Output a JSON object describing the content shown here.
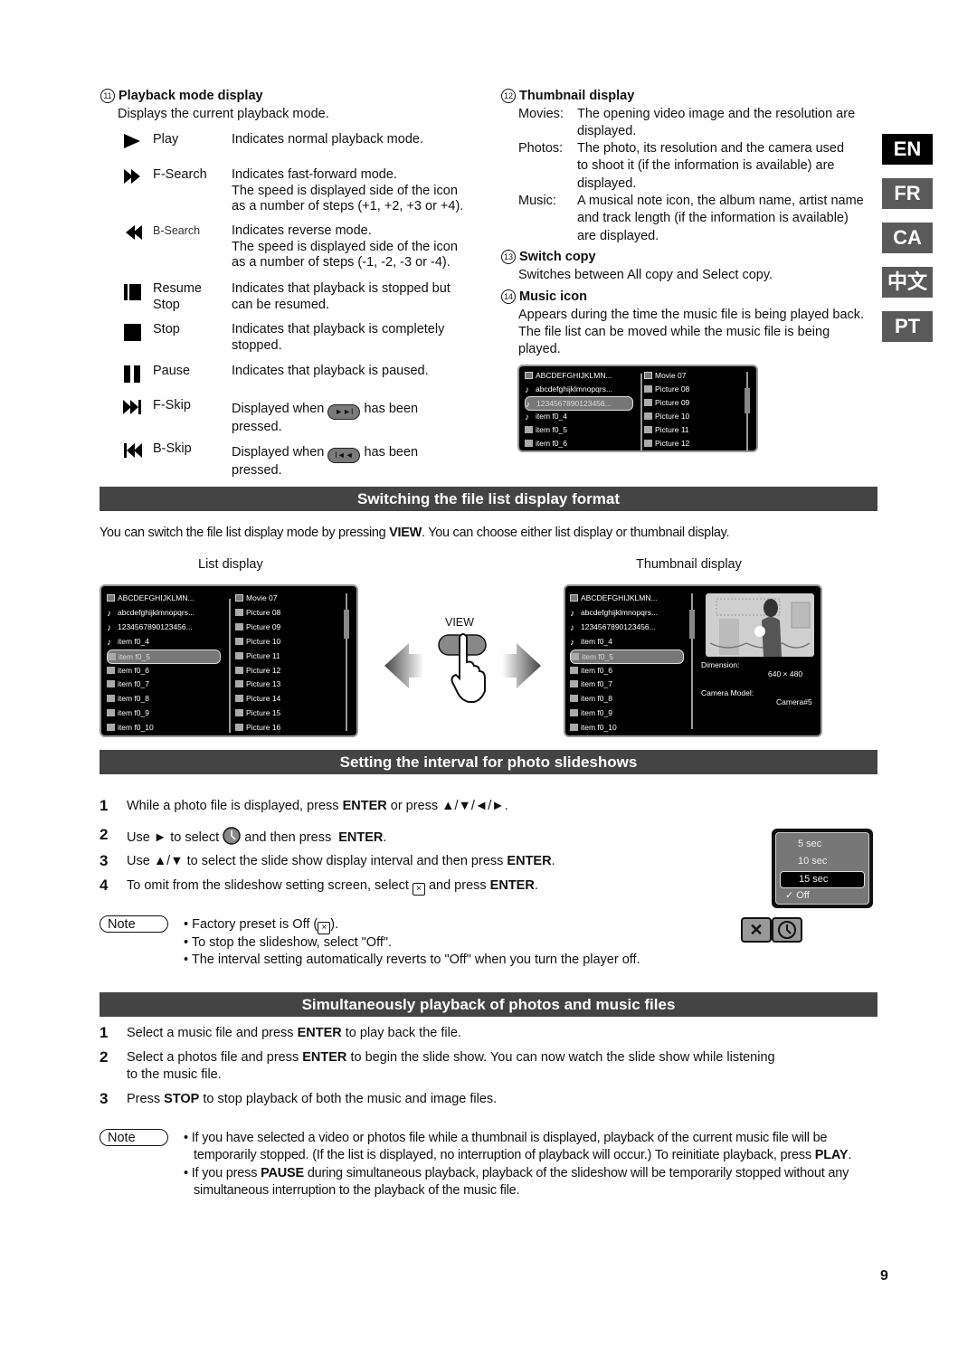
{
  "playback_mode": {
    "number": "11",
    "title": "Playback mode display",
    "intro": "Displays the current playback mode.",
    "modes": [
      {
        "icon": "play-icon",
        "name": "Play",
        "desc": "Indicates normal playback mode."
      },
      {
        "icon": "fast-forward-icon",
        "name": "F-Search",
        "desc": "Indicates fast-forward mode.",
        "desc2": "The speed is displayed side of the icon",
        "desc3": "as a number of steps (+1, +2, +3 or +4)."
      },
      {
        "icon": "rewind-icon",
        "name": "B-Search",
        "desc": "Indicates reverse mode.",
        "desc2": "The speed is displayed side of the icon",
        "desc3": "as a number of steps (-1, -2, -3 or -4)."
      },
      {
        "icon": "resume-stop-icon",
        "name": "Resume",
        "name2": "Stop",
        "desc": "Indicates that playback is stopped but",
        "desc2": "can be resumed."
      },
      {
        "icon": "stop-icon",
        "name": "Stop",
        "desc": "Indicates that playback is completely",
        "desc2": "stopped."
      },
      {
        "icon": "pause-icon",
        "name": "Pause",
        "desc": "Indicates that playback is paused."
      },
      {
        "icon": "skip-forward-icon",
        "name": "F-Skip",
        "desc_pre": "Displayed when",
        "desc_post": "has been",
        "desc2": "pressed.",
        "button_glyph": "►►I"
      },
      {
        "icon": "skip-back-icon",
        "name": "B-Skip",
        "desc_pre": "Displayed when",
        "desc_post": "has been",
        "desc2": "pressed.",
        "button_glyph": "I◄◄"
      }
    ]
  },
  "thumbnail_display": {
    "number": "12",
    "title": "Thumbnail display",
    "items": [
      {
        "key": "Movies:",
        "lines": [
          "The opening video image and the resolution are",
          "displayed."
        ]
      },
      {
        "key": "Photos:",
        "lines": [
          "The photo, its resolution and the camera used",
          "to shoot it (if the information is available) are",
          "displayed."
        ]
      },
      {
        "key": "Music:",
        "lines": [
          "A musical note icon, the album name, artist name",
          "and track length (if the information is available)",
          "are displayed."
        ]
      }
    ]
  },
  "switch_copy": {
    "number": "13",
    "title": "Switch copy",
    "text": "Switches between All copy and Select copy."
  },
  "music_icon": {
    "number": "14",
    "title": "Music icon",
    "lines": [
      "Appears during the time the music file is being played back.",
      "The file list can be moved while the music file is being",
      "played."
    ]
  },
  "music_screen": {
    "left": [
      {
        "type": "folder",
        "label": "ABCDEFGHIJKLMN..."
      },
      {
        "type": "note",
        "label": "abcdefghijklmnopqrs..."
      },
      {
        "type": "note",
        "label": "1234567890123456...",
        "selected": true
      },
      {
        "type": "note",
        "label": "item f0_4"
      },
      {
        "type": "photo",
        "label": "item f0_5"
      },
      {
        "type": "photo",
        "label": "item f0_6"
      }
    ],
    "right": [
      {
        "type": "folder",
        "label": "Movie 07"
      },
      {
        "type": "photo",
        "label": "Picture 08"
      },
      {
        "type": "photo",
        "label": "Picture 09"
      },
      {
        "type": "photo",
        "label": "Picture 10"
      },
      {
        "type": "photo",
        "label": "Picture 11"
      },
      {
        "type": "photo",
        "label": "Picture 12"
      }
    ]
  },
  "languages": [
    {
      "code": "EN",
      "active": true
    },
    {
      "code": "FR"
    },
    {
      "code": "CA"
    },
    {
      "code": "中文"
    },
    {
      "code": "PT"
    }
  ],
  "section_switch": {
    "title": "Switching the file list display format",
    "intro_pre": "You can switch the file list display mode by pressing ",
    "intro_bold": "VIEW",
    "intro_post": ". You can choose either list display or thumbnail display.",
    "list_label": "List display",
    "thumb_label": "Thumbnail display",
    "view_label": "VIEW"
  },
  "list_screen": {
    "left": [
      {
        "type": "folder",
        "label": "ABCDEFGHIJKLMN..."
      },
      {
        "type": "note",
        "label": "abcdefghijklmnopqrs..."
      },
      {
        "type": "note",
        "label": "1234567890123456..."
      },
      {
        "type": "note",
        "label": "item f0_4"
      },
      {
        "type": "photo",
        "label": "item f0_5",
        "selected": true
      },
      {
        "type": "photo",
        "label": "item f0_6"
      },
      {
        "type": "photo",
        "label": "item f0_7"
      },
      {
        "type": "photo",
        "label": "item f0_8"
      },
      {
        "type": "photo",
        "label": "item f0_9"
      },
      {
        "type": "photo",
        "label": "item f0_10"
      }
    ],
    "right": [
      {
        "type": "folder",
        "label": "Movie 07"
      },
      {
        "type": "photo",
        "label": "Picture 08"
      },
      {
        "type": "photo",
        "label": "Picture 09"
      },
      {
        "type": "photo",
        "label": "Picture 10"
      },
      {
        "type": "photo",
        "label": "Picture 11"
      },
      {
        "type": "photo",
        "label": "Picture 12"
      },
      {
        "type": "photo",
        "label": "Picture 13"
      },
      {
        "type": "photo",
        "label": "Picture 14"
      },
      {
        "type": "photo",
        "label": "Picture 15"
      },
      {
        "type": "photo",
        "label": "Picture 16"
      }
    ]
  },
  "thumb_screen": {
    "left": [
      {
        "type": "folder",
        "label": "ABCDEFGHIJKLMN..."
      },
      {
        "type": "note",
        "label": "abcdefghijklmnopqrs..."
      },
      {
        "type": "note",
        "label": "1234567890123456..."
      },
      {
        "type": "note",
        "label": "item f0_4"
      },
      {
        "type": "photo",
        "label": "item f0_5",
        "selected": true
      },
      {
        "type": "photo",
        "label": "item f0_6"
      },
      {
        "type": "photo",
        "label": "item f0_7"
      },
      {
        "type": "photo",
        "label": "item f0_8"
      },
      {
        "type": "photo",
        "label": "item f0_9"
      },
      {
        "type": "photo",
        "label": "item f0_10"
      }
    ],
    "dimension_label": "Dimension:",
    "dimension_value": "640 × 480",
    "camera_label": "Camera Model:",
    "camera_value": "Camera#5"
  },
  "section_interval": {
    "title": "Setting the interval for photo slideshows",
    "steps": [
      {
        "n": "1",
        "html": "While a photo file is displayed, press <b>ENTER</b> or press ▲/▼/◄/►."
      },
      {
        "n": "2",
        "html": "Use ► to select <span class='clk'></span> and then press &nbsp;<b>ENTER</b>."
      },
      {
        "n": "3",
        "html": "Use ▲/▼ to select the slide show display interval and then press <b>ENTER</b>."
      },
      {
        "n": "4",
        "html": "To omit from the slideshow setting screen, select <span class='xbox'>×</span> and press <b>ENTER</b>."
      }
    ],
    "note_label": "Note",
    "notes": [
      "Factory preset is Off (<span class='xbox'>×</span>).",
      "To stop the slideshow, select \"Off\".",
      "The interval setting automatically reverts to \"Off\" when you turn the player off."
    ],
    "menu": [
      {
        "label": "5 sec"
      },
      {
        "label": "10 sec"
      },
      {
        "label": "15 sec",
        "selected": true
      },
      {
        "label": "Off",
        "checked": true
      }
    ]
  },
  "section_simul": {
    "title": "Simultaneously playback of photos and music files",
    "steps": [
      {
        "n": "1",
        "html": "Select a music file and press <b>ENTER</b> to play back the file."
      },
      {
        "n": "2",
        "html": "Select a photos file and press <b>ENTER</b> to begin the slide show. You can now watch the slide show while listening<br>to the music file."
      },
      {
        "n": "3",
        "html": "Press <b>STOP</b> to stop playback of both the music and image files."
      }
    ],
    "note_label": "Note",
    "notes": [
      "If you have selected a video or photos file while a thumbnail is displayed, playback of the current music file will be<br>temporarily stopped. (If the list is displayed, no interruption of playback will occur.) To reinitiate playback, press <b>PLAY</b>.",
      "If you press <b>PAUSE</b> during simultaneous playback, playback of the slideshow will be temporarily stopped without any<br>simultaneous interruption to the playback of the music file."
    ]
  },
  "page_number": "9"
}
